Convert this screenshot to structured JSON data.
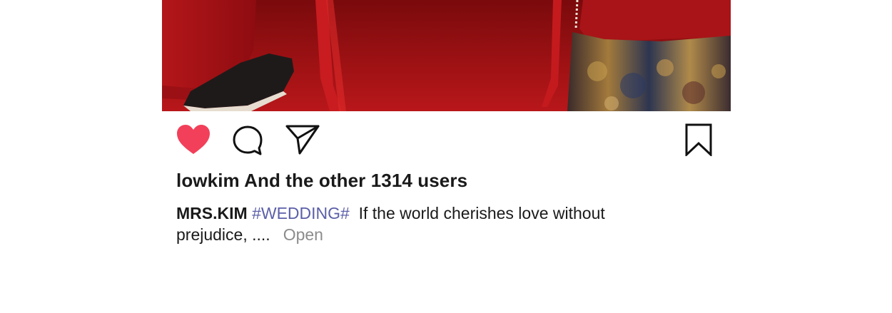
{
  "post": {
    "likes_text": "lowkim And the other 1314 users",
    "caption": {
      "username": "MRS.KIM",
      "hashtag": "#WEDDING#",
      "text_line1": "If the world cherishes love without",
      "text_line2": "prejudice, ....",
      "more_label": "Open"
    },
    "liked": true
  },
  "icons": {
    "like": "heart-icon",
    "comment": "comment-icon",
    "share": "send-icon",
    "save": "bookmark-icon"
  },
  "colors": {
    "heart": "#f2405a",
    "hashtag": "#5b5fa8",
    "more": "#8c8c8c",
    "photo_red": "#a30f12"
  }
}
